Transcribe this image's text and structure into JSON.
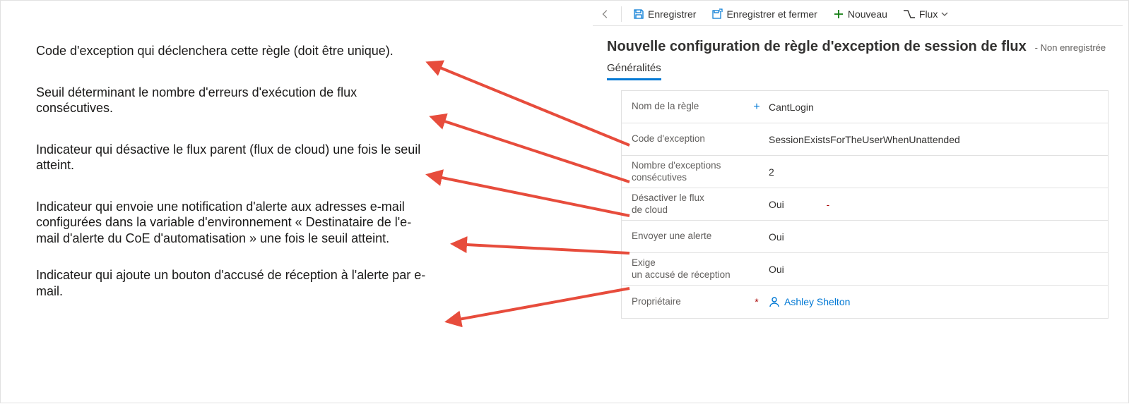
{
  "annotations": {
    "a1": "Code d'exception qui déclenchera cette règle (doit être unique).",
    "a2": "Seuil déterminant le nombre d'erreurs d'exécution de flux consécutives.",
    "a3": "Indicateur qui désactive le flux parent (flux de cloud) une fois le seuil atteint.",
    "a4": "Indicateur qui envoie une notification d'alerte aux adresses e-mail configurées dans la variable d'environnement « Destinataire de l'e-mail d'alerte du CoE d'automatisation » une fois le seuil atteint.",
    "a5": "Indicateur qui ajoute un bouton d'accusé de réception à l'alerte par e-mail."
  },
  "cmdbar": {
    "save": "Enregistrer",
    "saveclose": "Enregistrer et fermer",
    "new": "Nouveau",
    "flow": "Flux"
  },
  "header": {
    "title": "Nouvelle configuration de règle d'exception de session de flux",
    "unsaved": "- Non enregistrée"
  },
  "tabs": {
    "general": "Généralités"
  },
  "form": {
    "rule_name_label": "Nom de la règle",
    "rule_name_value": "CantLogin",
    "exception_code_label": "Code d'exception",
    "exception_code_value": "SessionExistsForTheUserWhenUnattended",
    "consec_label_l1": "Nombre d'exceptions",
    "consec_label_l2": "consécutives",
    "consec_value": "2",
    "disable_label_l1": "Désactiver le flux",
    "disable_label_l2": "de cloud",
    "disable_value": "Oui",
    "disable_mark": "-",
    "alert_label": "Envoyer une alerte",
    "alert_value": "Oui",
    "ack_label_l1": "Exige",
    "ack_label_l2": "un accusé de réception",
    "ack_value": "Oui",
    "owner_label": "Propriétaire",
    "owner_value": "Ashley Shelton"
  }
}
